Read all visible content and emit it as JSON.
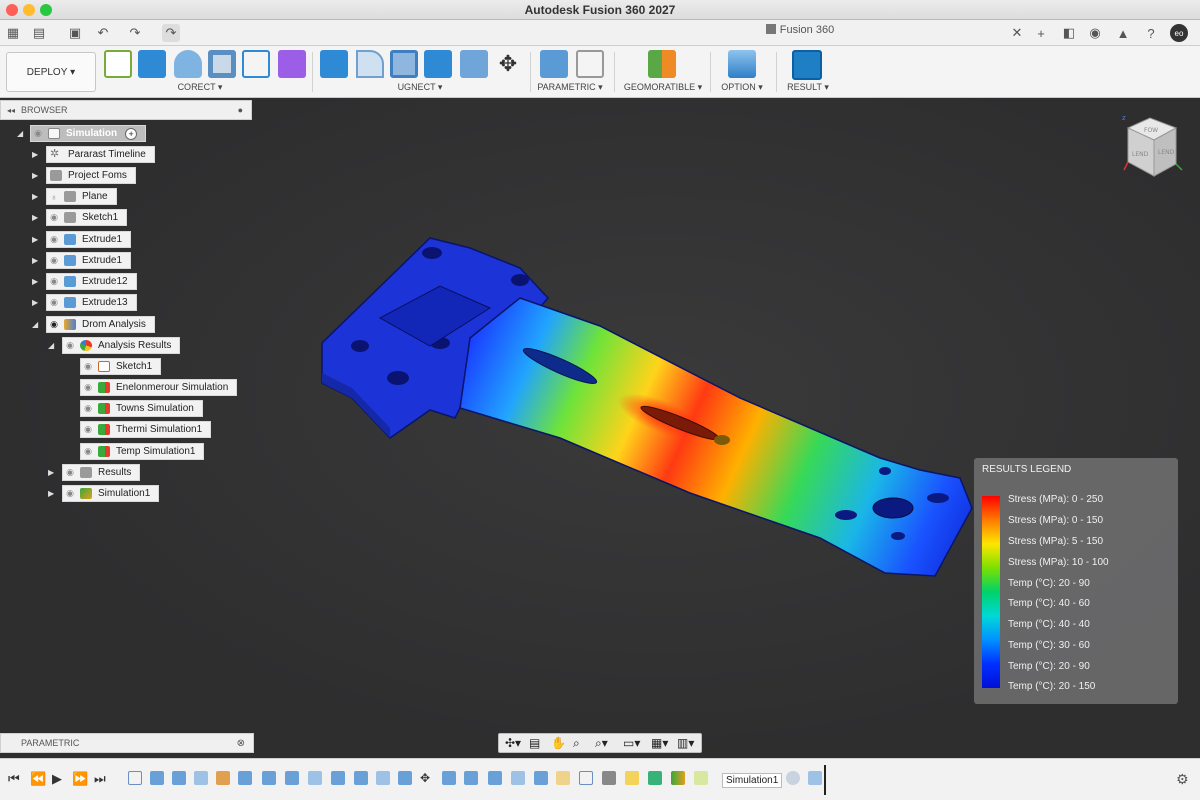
{
  "window": {
    "title": "Autodesk Fusion 360 2027",
    "doc_tab": "Fusion 360"
  },
  "toolbar": {
    "deploy_label": "DEPLOY",
    "groups": [
      "CORECT",
      "UGNECT",
      "PARAMETRIC",
      "GEOMORATIBLE",
      "OPTION",
      "RESULT"
    ]
  },
  "browser": {
    "title": "BROWSER",
    "items": [
      {
        "label": "Simulation"
      },
      {
        "label": "Pararast Timeline"
      },
      {
        "label": "Project Foms"
      },
      {
        "label": "Plane"
      },
      {
        "label": "Sketch1"
      },
      {
        "label": "Extrude1"
      },
      {
        "label": "Extrude1"
      },
      {
        "label": "Extrude12"
      },
      {
        "label": "Extrude13"
      },
      {
        "label": "Drom Analysis"
      },
      {
        "label": "Analysis Results"
      },
      {
        "label": "Sketch1"
      },
      {
        "label": "Enelonmerour Simulation"
      },
      {
        "label": "Towns Simulation"
      },
      {
        "label": "Thermi Simulation1"
      },
      {
        "label": "Temp Simulation1"
      },
      {
        "label": "Results"
      },
      {
        "label": "Simulation1"
      }
    ]
  },
  "viewcube": {
    "top": "FOW",
    "front": "LEND",
    "right": "LEND"
  },
  "legend": {
    "title": "RESULTS LEGEND",
    "items": [
      "Stress (MPa): 0 - 250",
      "Stress (MPa): 0 - 150",
      "Stress (MPa): 5 - 150",
      "Stress (MPa): 10 - 100",
      "Temp (°C): 20 - 90",
      "Temp (°C): 40 - 60",
      "Temp (°C): 40 - 40",
      "Temp (°C): 30 - 60",
      "Temp (°C): 20 - 90",
      "Temp (°C): 20 - 150"
    ]
  },
  "parametric_panel": {
    "label": "PARAMETRIC"
  },
  "timeline": {
    "current": "Simulation1"
  },
  "colors": {
    "accent": "#1e7fc4",
    "toolbar_bg": "#f4f4f4",
    "viewport_bg": "#2f2f30"
  }
}
